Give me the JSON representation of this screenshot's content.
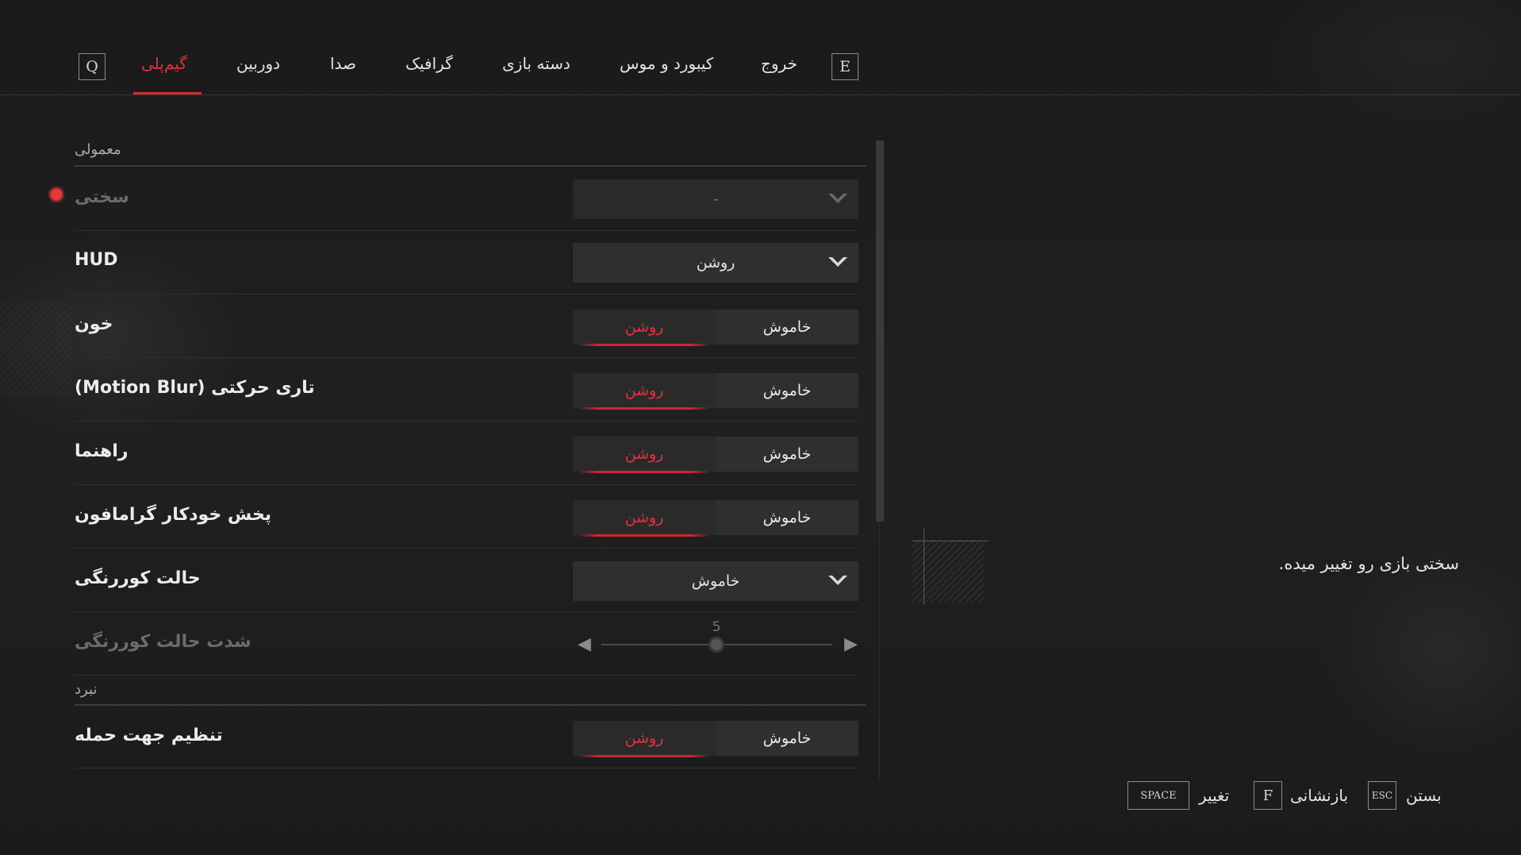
{
  "tabs": {
    "prev_key": "Q",
    "next_key": "E",
    "items": [
      {
        "label": "گیم‌پلی",
        "active": true
      },
      {
        "label": "دوربین"
      },
      {
        "label": "صدا"
      },
      {
        "label": "گرافیک"
      },
      {
        "label": "دسته بازی"
      },
      {
        "label": "کیبورد و موس"
      },
      {
        "label": "خروج"
      }
    ]
  },
  "sections": {
    "general_title": "معمولی",
    "combat_title": "نبرد"
  },
  "settings": {
    "difficulty": {
      "label": "سختی",
      "value": "-",
      "disabled": true
    },
    "hud": {
      "label": "HUD",
      "value": "روشن"
    },
    "blood": {
      "label": "خون",
      "on_label": "روشن",
      "off_label": "خاموش",
      "selected": "on"
    },
    "motion_blur": {
      "label": "تاری حرکتی (Motion Blur)",
      "on_label": "روشن",
      "off_label": "خاموش",
      "selected": "on"
    },
    "guide": {
      "label": "راهنما",
      "on_label": "روشن",
      "off_label": "خاموش",
      "selected": "on"
    },
    "gramophone": {
      "label": "پخش خودکار گرامافون",
      "on_label": "روشن",
      "off_label": "خاموش",
      "selected": "on"
    },
    "colorblind": {
      "label": "حالت کوررنگی",
      "value": "خاموش"
    },
    "colorblind_intensity": {
      "label": "شدت حالت کوررنگی",
      "value": "5",
      "min": 0,
      "max": 10,
      "disabled": true
    },
    "attack_direction": {
      "label": "تنظیم جهت حمله",
      "on_label": "روشن",
      "off_label": "خاموش",
      "selected": "on"
    }
  },
  "description": "سختی بازی رو تغییر میده.",
  "hints": {
    "close": {
      "key": "ESC",
      "label": "بستن"
    },
    "reset": {
      "key": "F",
      "label": "بازنشانی"
    },
    "change": {
      "key": "SPACE",
      "label": "تغییر"
    }
  },
  "colors": {
    "accent": "#e0333c",
    "background": "#1c1c1d",
    "control_bg": "#2f2f30"
  },
  "icons": {
    "arrow_left": "◀",
    "arrow_right": "▶"
  }
}
